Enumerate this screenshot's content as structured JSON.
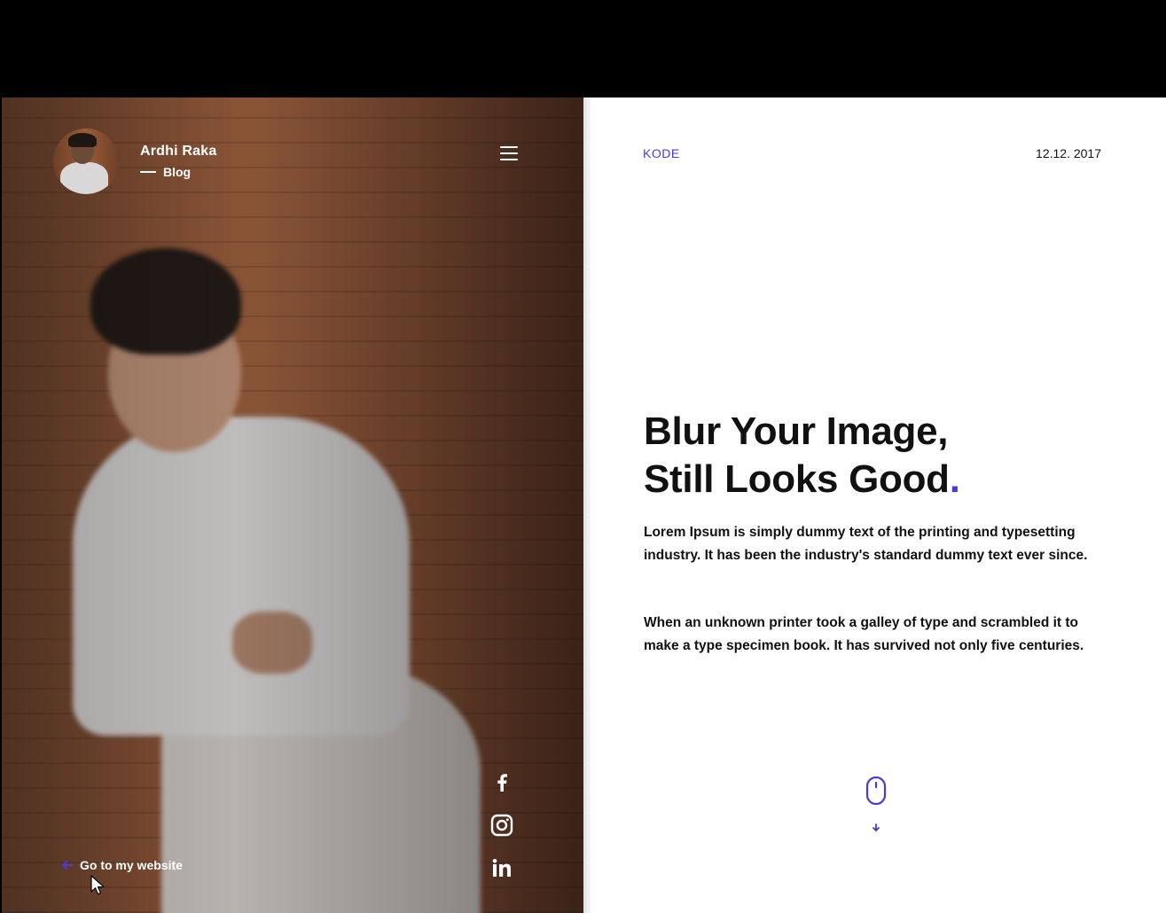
{
  "profile": {
    "name": "Ardhi Raka",
    "subtitle": "Blog"
  },
  "menu": {
    "icon": "hamburger-menu-icon"
  },
  "socials": [
    {
      "network": "Facebook",
      "icon": "facebook-icon"
    },
    {
      "network": "Instagram",
      "icon": "instagram-icon"
    },
    {
      "network": "LinkedIn",
      "icon": "linkedin-icon"
    }
  ],
  "website_link": {
    "label": "Go to my website",
    "icon": "arrow-left-icon"
  },
  "header": {
    "brand": "KODE",
    "date": "12.12. 2017"
  },
  "article": {
    "headline_line1": "Blur Your Image,",
    "headline_line2": "Still Looks Good",
    "headline_accent": ".",
    "paragraph1": "Lorem Ipsum is simply dummy text of the printing and typesetting industry. It has been the industry's standard dummy text ever since.",
    "paragraph2": "When an unknown printer took a galley of type and scrambled it to make a type specimen book. It has survived not only five centuries."
  },
  "scroll": {
    "icon": "mouse-scroll-icon"
  },
  "colors": {
    "accent": "#4a3bd6",
    "text": "#111111",
    "panel_light": "#ffffff",
    "frame": "#000000"
  }
}
